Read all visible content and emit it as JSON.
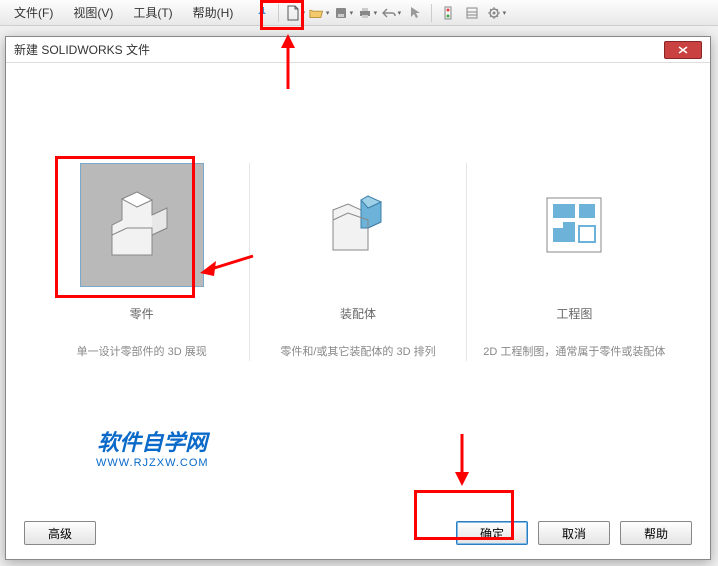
{
  "menubar": {
    "file": "文件(F)",
    "view": "视图(V)",
    "tools": "工具(T)",
    "help": "帮助(H)"
  },
  "dialog": {
    "title": "新建 SOLIDWORKS 文件",
    "options": {
      "part": {
        "title": "零件",
        "desc": "单一设计零部件的 3D 展现"
      },
      "assembly": {
        "title": "装配体",
        "desc": "零件和/或其它装配体的 3D 排列"
      },
      "drawing": {
        "title": "工程图",
        "desc": "2D 工程制图，通常属于零件或装配体"
      }
    },
    "buttons": {
      "advanced": "高级",
      "ok": "确定",
      "cancel": "取消",
      "help": "帮助"
    }
  },
  "watermark": {
    "line1": "软件自学网",
    "line2": "WWW.RJZXW.COM"
  }
}
